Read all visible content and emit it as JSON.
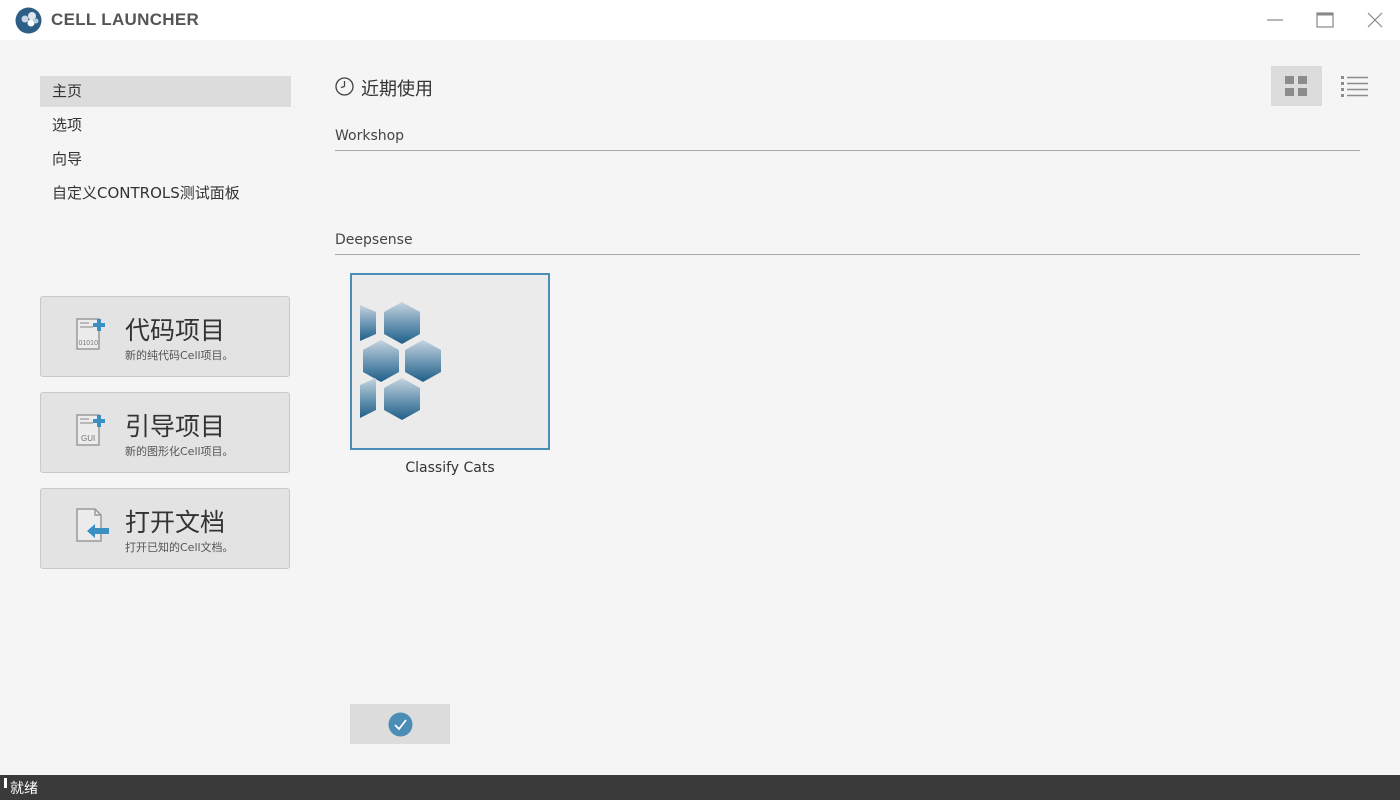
{
  "app": {
    "title": "CELL LAUNCHER"
  },
  "nav": {
    "items": [
      {
        "label": "主页",
        "active": true
      },
      {
        "label": "选项",
        "active": false
      },
      {
        "label": "向导",
        "active": false
      },
      {
        "label": "自定义CONTROLS测试面板",
        "active": false
      }
    ]
  },
  "actions": [
    {
      "title": "代码项目",
      "subtitle": "新的纯代码Cell项目。",
      "icon": "code-project-icon",
      "icon_text": "01010"
    },
    {
      "title": "引导项目",
      "subtitle": "新的图形化Cell项目。",
      "icon": "gui-project-icon",
      "icon_text": "GUI"
    },
    {
      "title": "打开文档",
      "subtitle": "打开已知的Cell文档。",
      "icon": "open-document-icon"
    }
  ],
  "recent": {
    "title": "近期使用",
    "view_mode": "grid",
    "sections": [
      {
        "label": "Workshop",
        "projects": []
      },
      {
        "label": "Deepsense",
        "projects": [
          {
            "name": "Classify Cats"
          }
        ]
      }
    ]
  },
  "status": {
    "text": "就绪"
  },
  "colors": {
    "accent": "#4b8db5",
    "statusbar": "#3a3a3a",
    "active_nav": "#dcdcdc"
  }
}
